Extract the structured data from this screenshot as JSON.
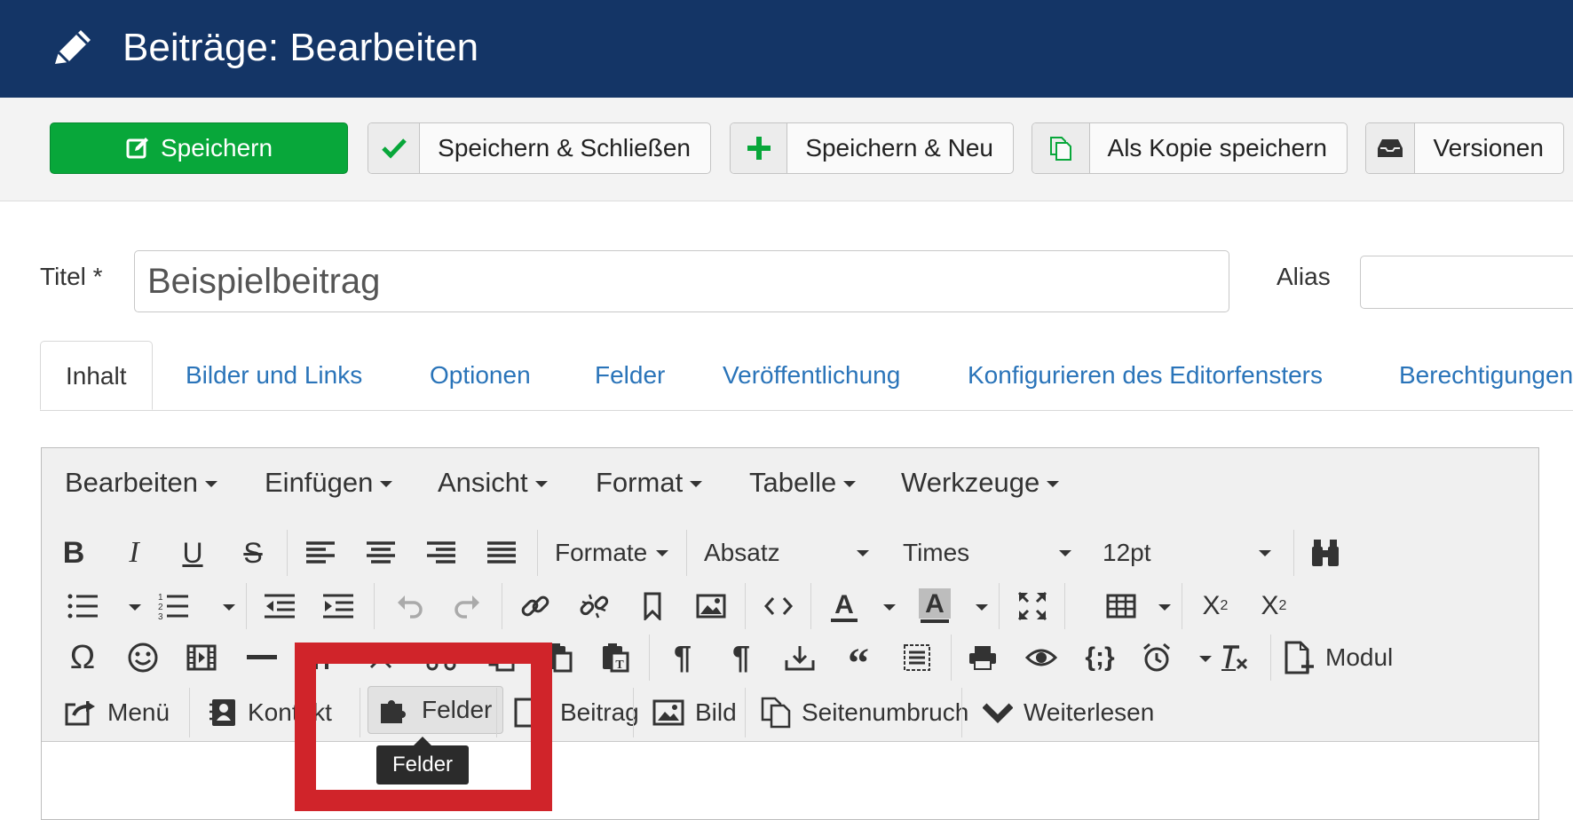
{
  "header": {
    "title": "Beiträge: Bearbeiten",
    "icon": "pencil-icon",
    "bg": "#143566"
  },
  "toolbar": {
    "save": "Speichern",
    "save_close": "Speichern & Schließen",
    "save_new": "Speichern & Neu",
    "save_copy": "Als Kopie speichern",
    "versions": "Versionen",
    "save_color": "#08a73a"
  },
  "form": {
    "title_label": "Titel *",
    "title_value": "Beispielbeitrag",
    "alias_label": "Alias",
    "alias_value": ""
  },
  "tabs": [
    {
      "label": "Inhalt",
      "active": true
    },
    {
      "label": "Bilder und Links"
    },
    {
      "label": "Optionen"
    },
    {
      "label": "Felder"
    },
    {
      "label": "Veröffentlichung"
    },
    {
      "label": "Konfigurieren des Editorfensters"
    },
    {
      "label": "Berechtigungen"
    }
  ],
  "editor": {
    "menus": [
      "Bearbeiten",
      "Einfügen",
      "Ansicht",
      "Format",
      "Tabelle",
      "Werkzeuge"
    ],
    "formats": "Formate",
    "block": "Absatz",
    "font": "Times",
    "size": "12pt",
    "module": "Modul",
    "plugins": [
      "Menü",
      "Kontakt",
      "Felder",
      "Beitrag",
      "Bild",
      "Seitenumbruch",
      "Weiterlesen"
    ],
    "tooltip": "Felder",
    "highlight_color": "#d0242a"
  }
}
